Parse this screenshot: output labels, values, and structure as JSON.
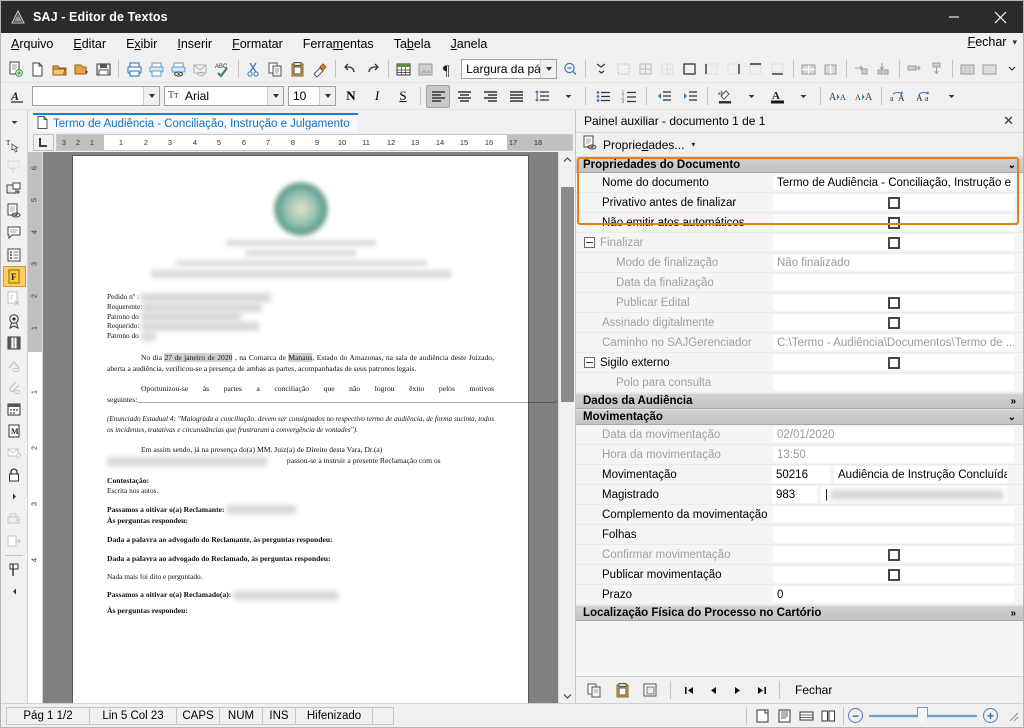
{
  "window": {
    "title": "SAJ - Editor de Textos",
    "app_icon": "saj-logo-icon",
    "minimize_label": "Minimizar",
    "close_label": "Fechar"
  },
  "menubar": {
    "items": [
      {
        "label": "Arquivo",
        "accel": "A"
      },
      {
        "label": "Editar",
        "accel": "E"
      },
      {
        "label": "Exibir",
        "accel": "x"
      },
      {
        "label": "Inserir",
        "accel": "I"
      },
      {
        "label": "Formatar",
        "accel": "F"
      },
      {
        "label": "Ferramentas",
        "accel": "m"
      },
      {
        "label": "Tabela",
        "accel": "b"
      },
      {
        "label": "Janela",
        "accel": "J"
      }
    ],
    "close_document_label": "Fechar"
  },
  "toolbar_main": {
    "icons": [
      "new-document-with-model-icon",
      "blank-document-icon",
      "open-folder-icon",
      "open-recent-icon",
      "save-icon",
      "print-icon",
      "print-preview-icon",
      "print-setup-icon",
      "send-mail-icon",
      "spellcheck-icon",
      "cut-icon",
      "copy-icon",
      "paste-icon",
      "format-painter-icon",
      "undo-icon",
      "redo-icon",
      "insert-table-icon",
      "insert-picture-icon",
      "paragraph-marks-icon"
    ],
    "zoom_combo_value": "Largura da págin",
    "zoom_icon": "zoom-out-icon",
    "overflow_icon": "chevron-double-down-icon",
    "extra_icons": [
      "select-table-icon",
      "borders-grid-icon",
      "no-borders-icon",
      "border-box-icon",
      "border-left-icon",
      "border-right-icon",
      "border-bottom-icon",
      "border-top-icon",
      "merge-cells-icon",
      "split-cells-icon",
      "insert-row-icon",
      "insert-column-icon",
      "delete-row-icon",
      "delete-column-icon",
      "table-autoformat-icon",
      "table-shading-icon",
      "toolbar-overflow-icon"
    ]
  },
  "toolbar_format": {
    "style_icon": "paragraph-style-icon",
    "style_value": "",
    "font_icon": "font-icon",
    "font_value": "Arial",
    "size_value": "10",
    "bold_label": "N",
    "italic_label": "I",
    "underline_label": "S",
    "icons": [
      "align-left-icon",
      "align-center-icon",
      "align-right-icon",
      "align-justify-icon",
      "line-spacing-icon",
      "bullets-icon",
      "numbering-icon",
      "decrease-indent-icon",
      "increase-indent-icon",
      "highlight-color-icon",
      "font-color-icon",
      "increase-font-icon",
      "decrease-font-icon",
      "uppercase-icon",
      "lowercase-icon"
    ]
  },
  "left_rail": {
    "top_caret": "chevron-down-icon",
    "icons": [
      "text-cursor-hand-icon",
      "text-box-icon",
      "insert-field-icon",
      "document-properties-icon",
      "comment-icon",
      "list-fields-icon",
      "form-field-icon",
      "delete-field-icon",
      "seal-stamp-icon",
      "film-strip-icon",
      "merge-docs-icon",
      "attachment-icon",
      "calendar-icon",
      "macro-icon",
      "envelope-edit-icon",
      "lock-icon",
      "expand-arrow-icon",
      "scanner-icon",
      "export-icon",
      "flag-marker-icon",
      "collapse-arrow-icon"
    ]
  },
  "document_tab": {
    "icon": "document-icon",
    "label": "Termo de Audiência - Conciliação, Instrução e Julgamento"
  },
  "ruler": {
    "tabstop_icon": "tab-left-icon",
    "h_numbers": [
      "3",
      "2",
      "1",
      "1",
      "2",
      "3",
      "4",
      "5",
      "6",
      "7",
      "8",
      "9",
      "10",
      "11",
      "12",
      "13",
      "14",
      "15",
      "16",
      "17",
      "18"
    ],
    "v_numbers": [
      "6",
      "5",
      "4",
      "3",
      "2",
      "1",
      "1",
      "2",
      "3",
      "4"
    ]
  },
  "document": {
    "header_redacted": true,
    "fields": [
      "Pedido nº :",
      "Requerente:",
      "Patrono do",
      "Requerido:",
      "Patrono do"
    ],
    "paragraphs": [
      {
        "type": "body",
        "prefix": "No dia ",
        "highlight1": "27 de janeiro de 2020",
        "mid": " , na Comarca de ",
        "highlight2": "Manaus",
        "suffix": ", Estado do Amazonas, na sala de audiência deste Juizado, aberta a audiência, verificou-se a presença de ambas as partes, acompanhadas de seus patronos legais."
      },
      {
        "type": "body",
        "text": "Oportunizou-se às partes a conciliação que não logrou êxito pelos motivos seguintes:______________________________________________________________________________________________________________."
      },
      {
        "type": "italic",
        "text": "(Enunciado Estadual 4: \"Malograda a conciliação, devem ser consignados no respectivo termo de audiência, de forma sucinta, todos os incidentes, tratativas e circunstâncias que frustraram a convergência de vontades\")."
      },
      {
        "type": "body",
        "text": "Em assim sendo, já na presença do(a) MM. Juiz(a) de Direito desta Vara, Dr.(a)"
      },
      {
        "type": "body",
        "text": "passou-se a instruir a presente Reclamação com os"
      },
      {
        "type": "bold",
        "text": "Contestação:"
      },
      {
        "type": "small",
        "text": "Escrita nos autos."
      },
      {
        "type": "bold",
        "text": "Passamos a oitivar o(a) Reclamante:"
      },
      {
        "type": "bold",
        "text": "Às perguntas respondeu:"
      },
      {
        "type": "bold",
        "text": "Dada a palavra ao advogado do Reclamante, às perguntas respondeu:"
      },
      {
        "type": "bold",
        "text": "Dada a palavra ao advogado do Reclamado, às perguntas respondeu:"
      },
      {
        "type": "small",
        "text": "Nada mais foi dito e perguntado."
      },
      {
        "type": "bold",
        "text": "Passamos a oitivar o(a) Reclamado(a):"
      },
      {
        "type": "bold",
        "text": "Às perguntas respondeu:"
      }
    ]
  },
  "panel": {
    "title": "Painel auxiliar - documento 1 de 1",
    "close_icon": "close-icon",
    "properties_button": {
      "icon": "properties-icon",
      "label": "Propriedades...",
      "dropdown": "chevron-down-icon"
    },
    "highlight_color": "#e8801a",
    "groups": [
      {
        "name": "Propriedades do Documento",
        "chevron": "chevron-double-down-icon",
        "highlighted": true,
        "rows": [
          {
            "label": "Nome do documento",
            "value": "Termo de Audiência - Conciliação, Instrução e ...",
            "type": "text",
            "indent": 1
          },
          {
            "label": "Privativo antes de finalizar",
            "value": "",
            "type": "checkbox",
            "checked": false,
            "indent": 1
          },
          {
            "label": "Não emitir atos automáticos",
            "value": "",
            "type": "checkbox",
            "checked": false,
            "indent": 1
          }
        ]
      },
      {
        "name": "",
        "rows": [
          {
            "label": "Finalizar",
            "value": "",
            "type": "checkbox",
            "checked": false,
            "indent": 0,
            "expander": true,
            "dim": true
          },
          {
            "label": "Modo de finalização",
            "value": "Não finalizado",
            "type": "text",
            "indent": 2,
            "dim": true,
            "value_dim": true
          },
          {
            "label": "Data da finalização",
            "value": "",
            "type": "text",
            "indent": 2,
            "dim": true
          },
          {
            "label": "Publicar Edital",
            "value": "",
            "type": "checkbox",
            "checked": false,
            "indent": 2,
            "dim": true
          },
          {
            "label": "Assinado digitalmente",
            "value": "",
            "type": "checkbox",
            "checked": false,
            "indent": 1,
            "dim": true
          },
          {
            "label": "Caminho no SAJGerenciador",
            "value": "C:\\Termo - Audiência\\Documentos\\Termo de ...",
            "type": "text",
            "indent": 1,
            "dim": true,
            "value_dim": true
          },
          {
            "label": "Sigilo externo",
            "value": "",
            "type": "checkbox",
            "checked": false,
            "indent": 0,
            "expander": true
          },
          {
            "label": "Polo para consulta",
            "value": "",
            "type": "text",
            "indent": 2,
            "dim": true
          }
        ]
      },
      {
        "name": "Dados da Audiência",
        "chevron": "chevron-double-right-icon",
        "rows": []
      },
      {
        "name": "Movimentação",
        "chevron": "chevron-double-down-icon",
        "rows": [
          {
            "label": "Data da movimentação",
            "value": "02/01/2020",
            "type": "text",
            "indent": 1,
            "dim": true,
            "value_dim": true
          },
          {
            "label": "Hora da movimentação",
            "value": "13:50",
            "type": "text",
            "indent": 1,
            "dim": true,
            "value_dim": true
          },
          {
            "label": "Movimentação",
            "value": "50216",
            "value2": "Audiência de Instrução Concluída",
            "type": "split",
            "indent": 1
          },
          {
            "label": "Magistrado",
            "value": "983",
            "value2": "",
            "value2_redacted": true,
            "type": "split",
            "indent": 1
          },
          {
            "label": "Complemento da movimentação",
            "value": "",
            "type": "text",
            "indent": 1
          },
          {
            "label": "Folhas",
            "value": "",
            "type": "text",
            "indent": 1
          },
          {
            "label": "Confirmar movimentação",
            "value": "",
            "type": "checkbox",
            "checked": false,
            "indent": 1,
            "dim": true
          },
          {
            "label": "Publicar movimentação",
            "value": "",
            "type": "checkbox",
            "checked": false,
            "indent": 1
          },
          {
            "label": "Prazo",
            "value": "0",
            "type": "text",
            "indent": 1
          }
        ]
      },
      {
        "name": "Localização Física do Processo no Cartório",
        "chevron": "chevron-double-right-icon",
        "rows": []
      }
    ],
    "footer": {
      "icons": [
        "copy-icon",
        "paste-icon",
        "copy-all-icon"
      ],
      "nav": [
        "first-record-icon",
        "previous-record-icon",
        "next-record-icon",
        "last-record-icon"
      ],
      "close_label": "Fechar"
    }
  },
  "statusbar": {
    "cells": [
      "Pág 1    1/2",
      "Lin 5  Col 23",
      "CAPS",
      "NUM",
      "INS",
      "Hifenizado",
      ""
    ],
    "view_icons": [
      "print-layout-icon",
      "reading-layout-icon",
      "web-layout-icon",
      "two-page-icon"
    ],
    "zoom_out_label": "−",
    "zoom_in_label": "+",
    "resize_grip": "resize-grip-icon"
  }
}
